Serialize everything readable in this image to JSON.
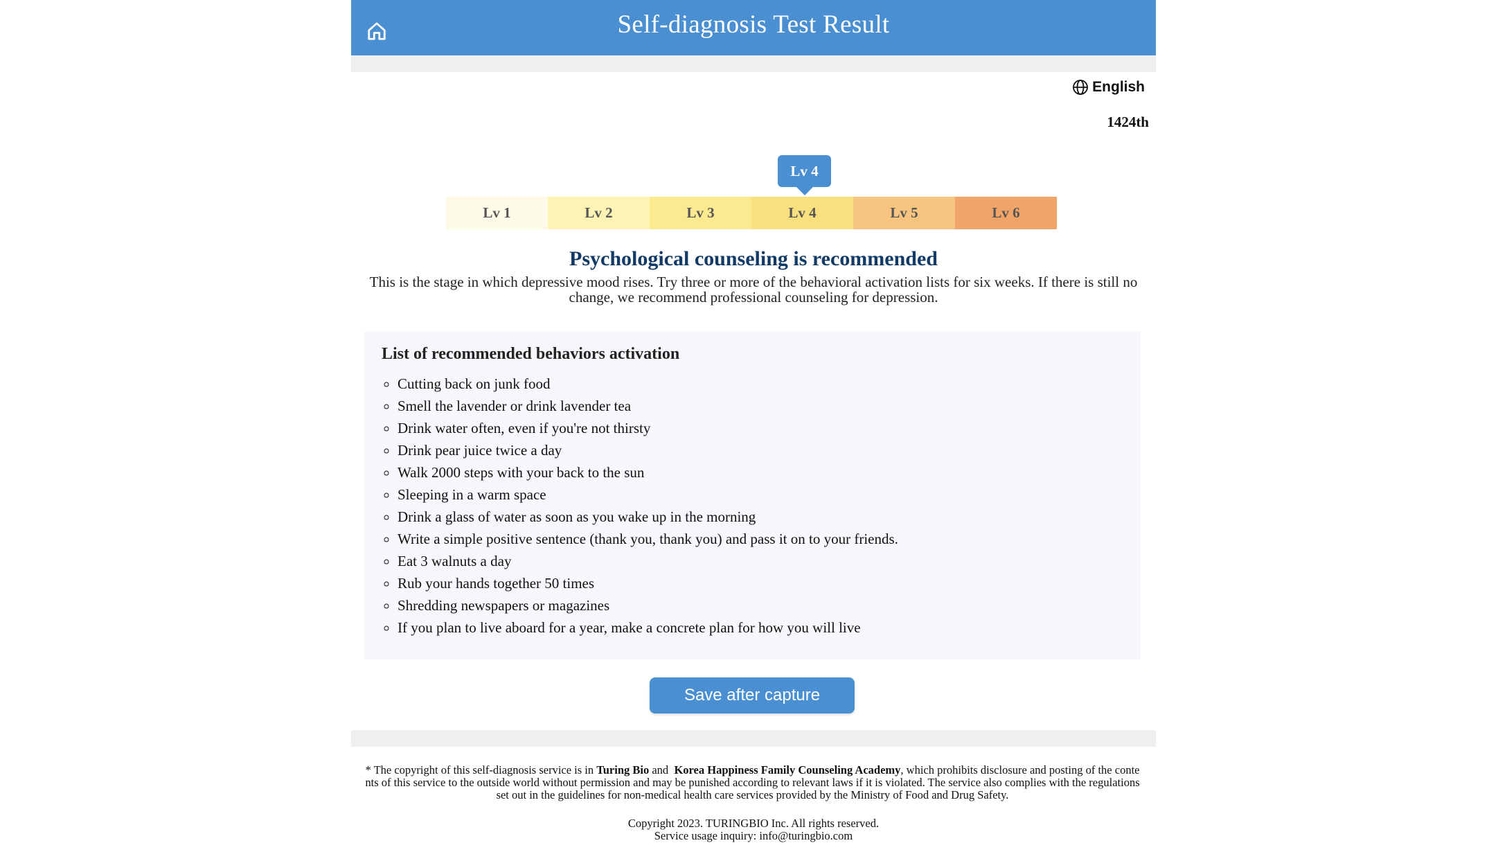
{
  "header": {
    "title": "Self-diagnosis Test Result"
  },
  "language": {
    "label": "English"
  },
  "participant_count": "1424th",
  "levels": {
    "items": [
      {
        "label": "Lv 1",
        "color": "#fdfbe8"
      },
      {
        "label": "Lv 2",
        "color": "#fdf3b4"
      },
      {
        "label": "Lv 3",
        "color": "#fbea8f"
      },
      {
        "label": "Lv 4",
        "color": "#f9e07e"
      },
      {
        "label": "Lv 5",
        "color": "#f6c47e"
      },
      {
        "label": "Lv 6",
        "color": "#f0a467"
      }
    ],
    "current": "Lv 4"
  },
  "result": {
    "title": "Psychological counseling is recommended",
    "description": "This is the stage in which depressive mood rises. Try three or more of the behavioral activation lists for six weeks. If there is still no change, we recommend professional counseling for depression."
  },
  "recommendations": {
    "title": "List of recommended behaviors activation",
    "items": [
      "Cutting back on junk food",
      "Smell the lavender or drink lavender tea",
      "Drink water often, even if you're not thirsty",
      "Drink pear juice twice a day",
      "Walk 2000 steps with your back to the sun",
      "Sleeping in a warm space",
      "Drink a glass of water as soon as you wake up in the morning",
      "Write a simple positive sentence (thank you, thank you) and pass it on to your friends.",
      "Eat 3 walnuts a day",
      "Rub your hands together 50 times",
      "Shredding newspapers or magazines",
      "If you plan to live aboard for a year, make a concrete plan for how you will live"
    ]
  },
  "save_button": {
    "label": "Save after capture"
  },
  "footer": {
    "notice_prefix": "* The copyright of this self-diagnosis service is in ",
    "company1": "Turing Bio",
    "notice_and": " and  ",
    "company2": "Korea Happiness Family Counseling Academy",
    "notice_suffix": ", which prohibits disclosure and posting of the contents of this service to the outside world without permission and may be punished according to relevant laws if it is violated. The service also complies with the regulations set out in the guidelines for non-medical health care services provided by the Ministry of Food and Drug Safety.",
    "copyright": "Copyright 2023. TURINGBIO Inc. All rights reserved.",
    "inquiry": "Service usage inquiry: info@turingbio.com"
  },
  "colors": {
    "primary": "#4a8fd1",
    "heading": "#123a66",
    "strip": "#efefef",
    "box_bg": "#f7f7fb"
  },
  "icons": {
    "home": "home-icon",
    "language": "globe-icon"
  }
}
